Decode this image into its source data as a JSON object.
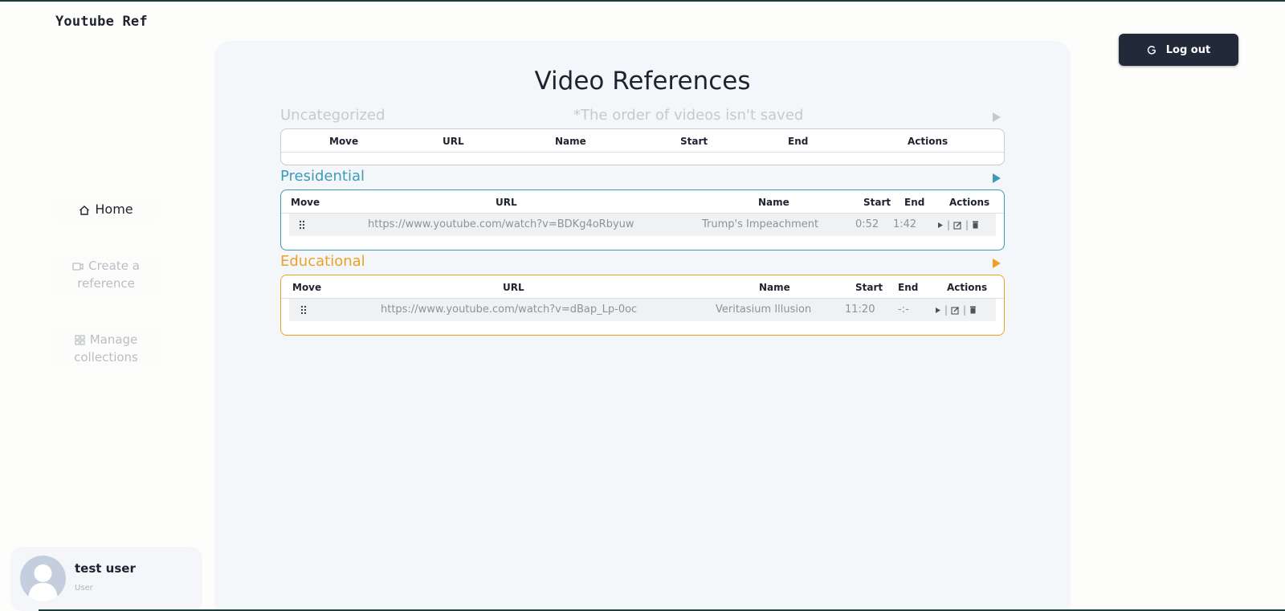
{
  "app": {
    "brand": "Youtube Ref"
  },
  "nav": {
    "home": "Home",
    "create": "Create a reference",
    "manage": "Manage collections"
  },
  "user": {
    "name": "test user",
    "role": "User"
  },
  "header": {
    "logout_label": "Log out"
  },
  "main": {
    "title": "Video References",
    "order_note": "*The order of videos isn't saved"
  },
  "columns": {
    "move": "Move",
    "url": "URL",
    "name": "Name",
    "start": "Start",
    "end": "End",
    "actions": "Actions"
  },
  "sections": [
    {
      "title": "Uncategorized",
      "color": "#c6cacf",
      "rows": []
    },
    {
      "title": "Presidential",
      "color": "#3d9ab9",
      "rows": [
        {
          "url": "https://www.youtube.com/watch?v=BDKg4oRbyuw",
          "name": "Trump's Impeachment",
          "start": "0:52",
          "end": "1:42"
        }
      ]
    },
    {
      "title": "Educational",
      "color": "#eca126",
      "rows": [
        {
          "url": "https://www.youtube.com/watch?v=dBap_Lp-0oc",
          "name": "Veritasium Illusion",
          "start": "11:20",
          "end": "-:-"
        }
      ]
    }
  ],
  "icons": {
    "home": "home-icon",
    "create": "create-icon",
    "manage": "grid-icon",
    "logout": "logout-icon",
    "drag": "drag-handle-icon",
    "play": "play-icon",
    "edit": "edit-icon",
    "delete": "trash-icon",
    "expand": "play-triangle-icon"
  }
}
